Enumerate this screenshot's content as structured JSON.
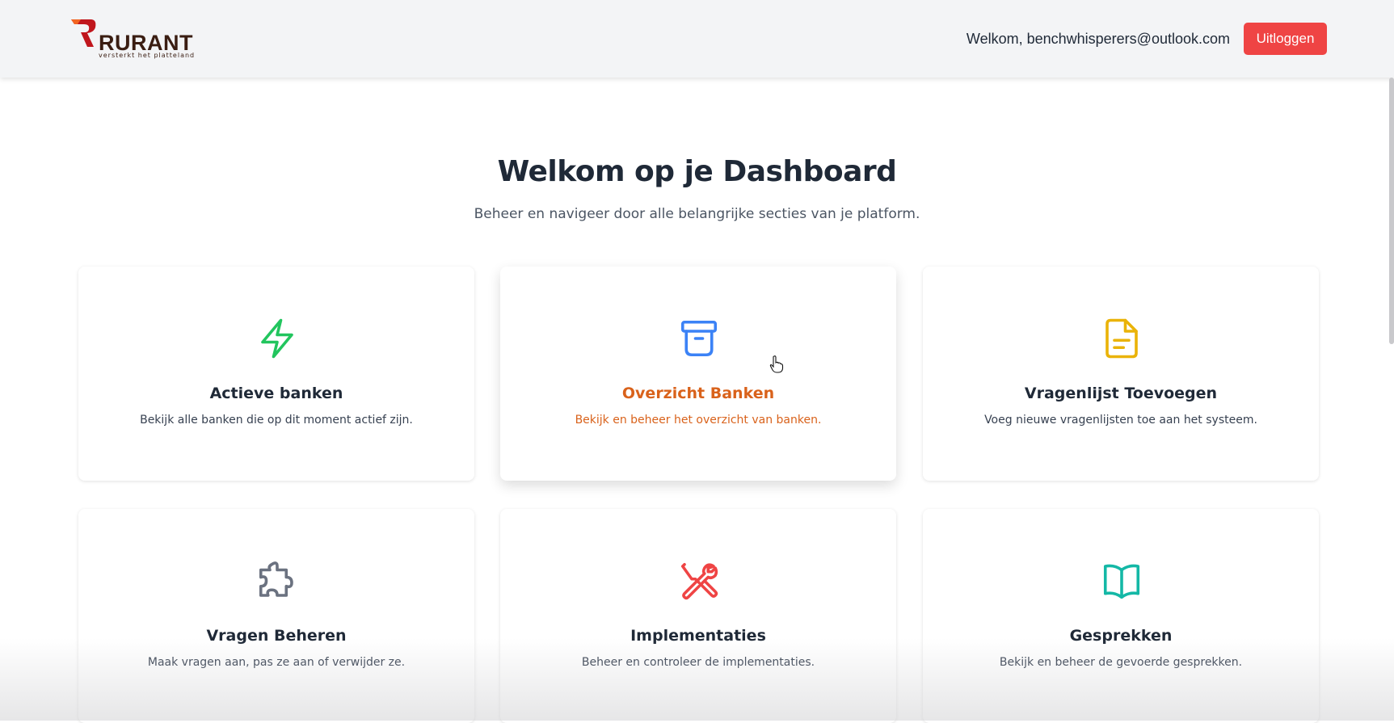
{
  "header": {
    "logo_word": "RURANT",
    "logo_tagline": "versterkt het platteland",
    "welcome_text": "Welkom, benchwhisperers@outlook.com",
    "logout_label": "Uitloggen"
  },
  "main": {
    "title": "Welkom op je Dashboard",
    "subtitle": "Beheer en navigeer door alle belangrijke secties van je platform."
  },
  "cards": [
    {
      "title": "Actieve banken",
      "description": "Bekijk alle banken die op dit moment actief zijn.",
      "icon": "lightning-icon",
      "color": "#22c55e"
    },
    {
      "title": "Overzicht Banken",
      "description": "Bekijk en beheer het overzicht van banken.",
      "icon": "archive-box-icon",
      "color": "#3b82f6"
    },
    {
      "title": "Vragenlijst Toevoegen",
      "description": "Voeg nieuwe vragenlijsten toe aan het systeem.",
      "icon": "document-icon",
      "color": "#eab308"
    },
    {
      "title": "Vragen Beheren",
      "description": "Maak vragen aan, pas ze aan of verwijder ze.",
      "icon": "puzzle-icon",
      "color": "#6b7280"
    },
    {
      "title": "Implementaties",
      "description": "Beheer en controleer de implementaties.",
      "icon": "tools-icon",
      "color": "#ef4444"
    },
    {
      "title": "Gesprekken",
      "description": "Bekijk en beheer de gevoerde gesprekken.",
      "icon": "open-book-icon",
      "color": "#14b8a6"
    }
  ],
  "colors": {
    "logout_button": "#ef4444",
    "hover_text": "#d9621b"
  }
}
